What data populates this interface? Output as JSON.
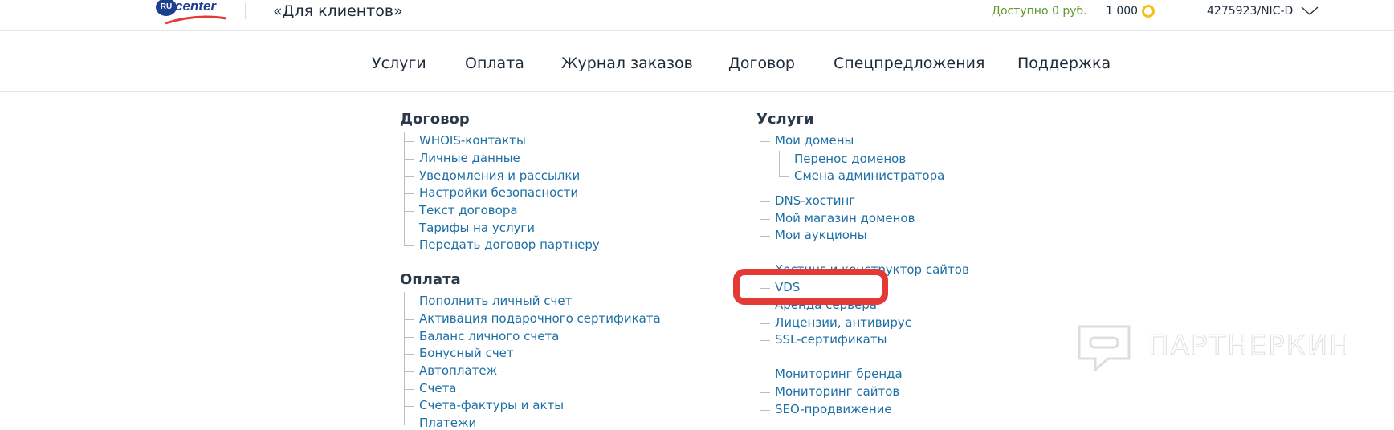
{
  "header": {
    "logo_badge": "RU",
    "logo_text": "center",
    "site_title": "«Для клиентов»",
    "balance": "Доступно 0 руб.",
    "bonus": "1 000",
    "account": "4275923/NIC-D"
  },
  "nav": [
    "Услуги",
    "Оплата",
    "Журнал заказов",
    "Договор",
    "Спецпредложения",
    "Поддержка"
  ],
  "sitemap": {
    "contract": {
      "title": "Договор",
      "items": [
        "WHOIS-контакты",
        "Личные данные",
        "Уведомления и рассылки",
        "Настройки безопасности",
        "Текст договора",
        "Тарифы на услуги",
        "Передать договор партнеру"
      ]
    },
    "payment": {
      "title": "Оплата",
      "items": [
        "Пополнить личный счет",
        "Активация подарочного сертификата",
        "Баланс личного счета",
        "Бонусный счет",
        "Автоплатеж",
        "Счета",
        "Счета-фактуры и акты",
        "Платежи"
      ]
    },
    "services": {
      "title": "Услуги",
      "domains": "Мои домены",
      "domain_sub": [
        "Перенос доменов",
        "Смена администратора"
      ],
      "group1": [
        "DNS-хостинг",
        "Мой магазин доменов",
        "Мои аукционы"
      ],
      "group2": [
        "Хостинг и конструктор сайтов",
        "VDS",
        "Аренда сервера",
        "Лицензии, антивирус",
        "SSL-сертификаты"
      ],
      "group3": [
        "Мониторинг бренда",
        "Мониторинг сайтов",
        "SEO-продвижение"
      ]
    }
  },
  "watermark": "ПАРТНЕРКИН",
  "colors": {
    "link": "#1d6fa5",
    "balance": "#5f9a2f",
    "highlight": "#e53935",
    "coin": "#f2c21b",
    "brand": "#1d3f8f"
  }
}
